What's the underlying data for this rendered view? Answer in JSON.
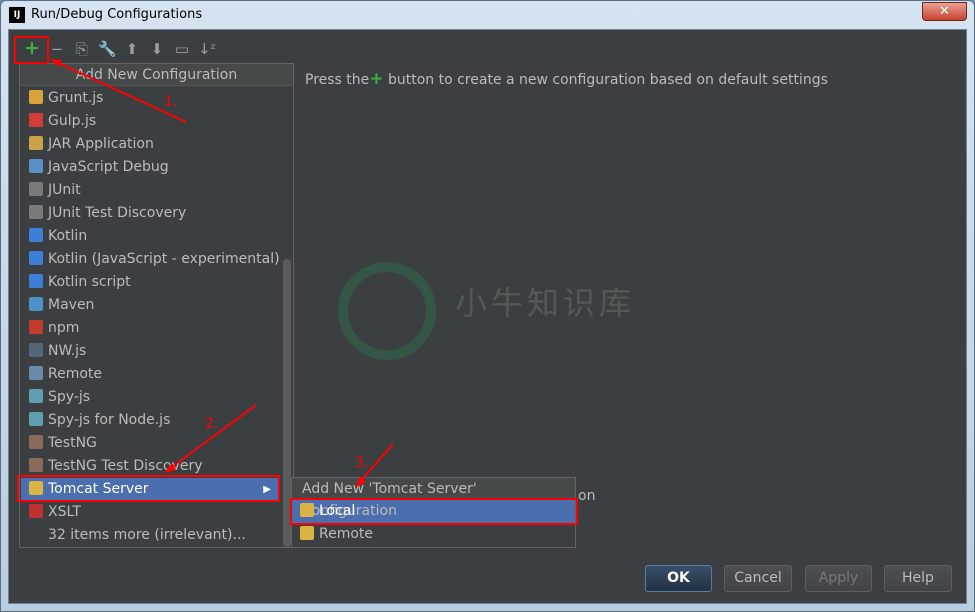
{
  "window": {
    "title": "Run/Debug Configurations",
    "logo": "IJ",
    "close": "✕"
  },
  "toolbar": [
    {
      "name": "add-icon",
      "glyph": "+"
    },
    {
      "name": "remove-icon",
      "glyph": "−"
    },
    {
      "name": "copy-icon",
      "glyph": "⎘"
    },
    {
      "name": "wrench-icon",
      "glyph": "🔧"
    },
    {
      "name": "move-up-icon",
      "glyph": "⬆"
    },
    {
      "name": "move-down-icon",
      "glyph": "⬇"
    },
    {
      "name": "folder-icon",
      "glyph": "▭"
    },
    {
      "name": "sort-icon",
      "glyph": "↓ᶻ"
    }
  ],
  "hint": {
    "before": "Press the",
    "plus": "+",
    "after": " button to create a new configuration based on default settings"
  },
  "list": {
    "header": "Add New Configuration",
    "items": [
      {
        "label": "Grunt.js",
        "color": "#d9a23a"
      },
      {
        "label": "Gulp.js",
        "color": "#d43b3b"
      },
      {
        "label": "JAR Application",
        "color": "#c9a24a"
      },
      {
        "label": "JavaScript Debug",
        "color": "#5a8fc8"
      },
      {
        "label": "JUnit",
        "color": "#7a7a7a"
      },
      {
        "label": "JUnit Test Discovery",
        "color": "#7a7a7a"
      },
      {
        "label": "Kotlin",
        "color": "#3d7fd6"
      },
      {
        "label": "Kotlin (JavaScript - experimental)",
        "color": "#3d7fd6"
      },
      {
        "label": "Kotlin script",
        "color": "#3d7fd6"
      },
      {
        "label": "Maven",
        "color": "#4f8fc8"
      },
      {
        "label": "npm",
        "color": "#c23b2b"
      },
      {
        "label": "NW.js",
        "color": "#556677"
      },
      {
        "label": "Remote",
        "color": "#6a8aa8"
      },
      {
        "label": "Spy-js",
        "color": "#5f9fb0"
      },
      {
        "label": "Spy-js for Node.js",
        "color": "#5f9fb0"
      },
      {
        "label": "TestNG",
        "color": "#8a6a5a"
      },
      {
        "label": "TestNG Test Discovery",
        "color": "#8a6a5a"
      },
      {
        "label": "Tomcat Server",
        "color": "#d9b440",
        "selected": true,
        "submenu": true
      },
      {
        "label": "XSLT",
        "color": "#c03030"
      },
      {
        "label": "32 items more (irrelevant)...",
        "color": ""
      }
    ]
  },
  "submenu": {
    "header": "Add New 'Tomcat Server' Configuration",
    "items": [
      {
        "label": "Local",
        "selected": true
      },
      {
        "label": "Remote"
      }
    ]
  },
  "behind_text": "on",
  "watermark": "小牛知识库",
  "buttons": {
    "ok": "OK",
    "cancel": "Cancel",
    "apply": "Apply",
    "help": "Help"
  },
  "annotations": [
    "1.",
    "2.",
    "3."
  ],
  "colors": {
    "accent": "#4b6eaf",
    "annotation": "#ff0000",
    "background": "#3c3f41"
  }
}
